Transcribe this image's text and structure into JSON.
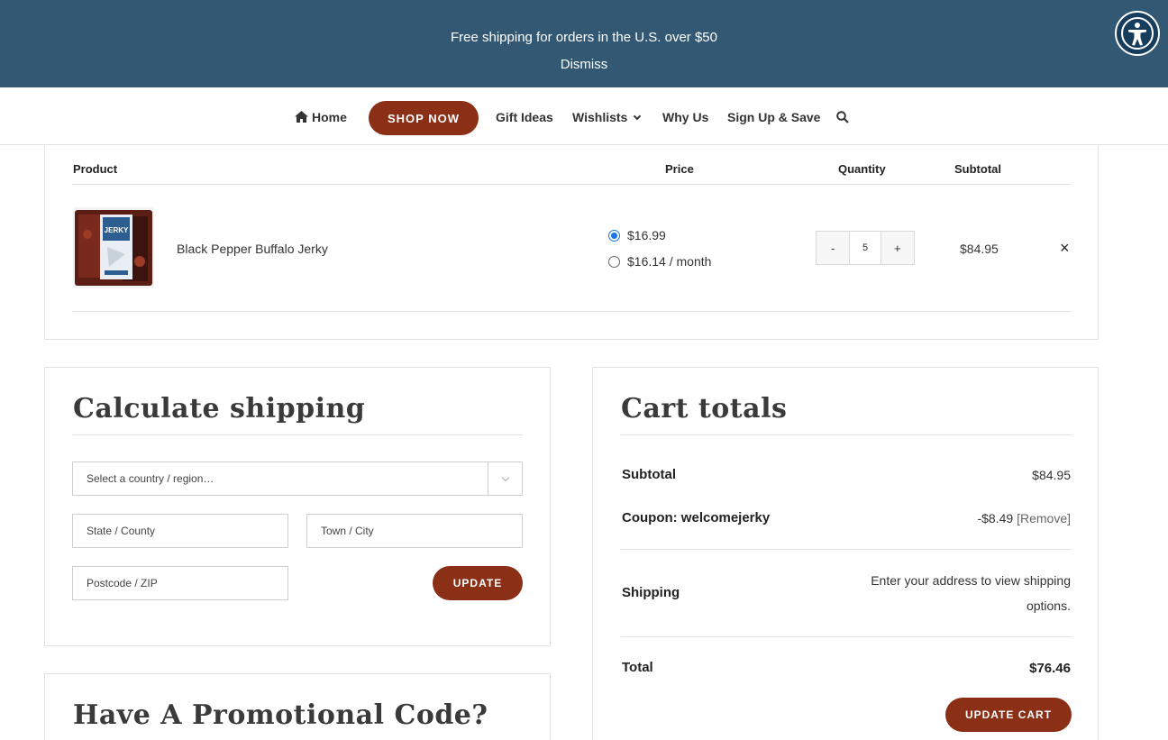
{
  "banner": {
    "message": "Free shipping for orders in the U.S. over $50",
    "dismiss": "Dismiss",
    "background": "#325873"
  },
  "nav": {
    "home": "Home",
    "shop_now": "SHOP NOW",
    "gift_ideas": "Gift Ideas",
    "wishlists": "Wishlists",
    "why_us": "Why Us",
    "sign_up": "Sign Up & Save",
    "accent": "#8b2f16"
  },
  "cart": {
    "headers": {
      "product": "Product",
      "price": "Price",
      "quantity": "Quantity",
      "subtotal": "Subtotal"
    },
    "item": {
      "name": "Black Pepper Buffalo Jerky",
      "price_one_time": "$16.99",
      "price_subscription": "$16.14 / month",
      "selected_option": "one-time",
      "quantity": "5",
      "minus": "-",
      "plus": "+",
      "subtotal": "$84.95",
      "remove": "×",
      "package_text": "JERKY"
    }
  },
  "shipping": {
    "title": "Calculate shipping",
    "country_placeholder": "Select a country / region…",
    "state_placeholder": "State / County",
    "city_placeholder": "Town / City",
    "zip_placeholder": "Postcode / ZIP",
    "update": "UPDATE"
  },
  "promo": {
    "title": "Have A Promotional Code?"
  },
  "totals": {
    "title": "Cart totals",
    "subtotal_label": "Subtotal",
    "subtotal_value": "$84.95",
    "coupon_label": "Coupon: welcomejerky",
    "coupon_value": "-$8.49",
    "coupon_remove": "[Remove]",
    "shipping_label": "Shipping",
    "shipping_note": "Enter your address to view shipping options.",
    "total_label": "Total",
    "total_value": "$76.46",
    "update_cart": "UPDATE CART"
  },
  "icons": {
    "home": "house-icon",
    "search": "magnifier-icon",
    "accessibility": "person-circle-icon"
  }
}
